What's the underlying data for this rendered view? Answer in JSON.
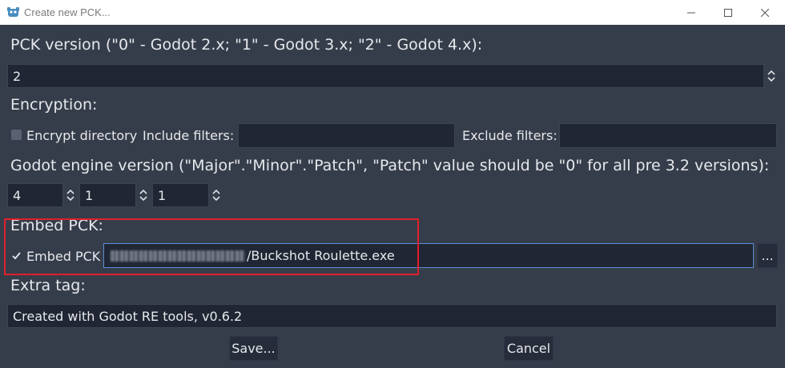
{
  "window": {
    "title": "Create new PCK...",
    "icons": {
      "app": "godot-re-icon",
      "minimize": "minimize-icon",
      "maximize": "maximize-icon",
      "close": "close-icon"
    }
  },
  "pck_version": {
    "label": "PCK version (\"0\" - Godot 2.x; \"1\" - Godot 3.x; \"2\" - Godot 4.x):",
    "value": "2"
  },
  "encryption": {
    "label": "Encryption:",
    "encrypt_directory_label": "Encrypt directory",
    "encrypt_directory_checked": false,
    "include_filters_label": "Include filters:",
    "include_filters_value": "",
    "exclude_filters_label": "Exclude filters:",
    "exclude_filters_value": ""
  },
  "engine_version": {
    "label": "Godot engine version (\"Major\".\"Minor\".\"Patch\", \"Patch\" value should be \"0\" for all pre 3.2 versions):",
    "major": "4",
    "minor": "1",
    "patch": "1"
  },
  "embed": {
    "label": "Embed PCK:",
    "checkbox_label": "Embed PCK",
    "checked": true,
    "path_visible": "/Buckshot Roulette.exe",
    "browse_label": "..."
  },
  "extra_tag": {
    "label": "Extra tag:",
    "value": "Created with Godot RE tools, v0.6.2"
  },
  "buttons": {
    "save": "Save...",
    "cancel": "Cancel"
  },
  "colors": {
    "background": "#363d4a",
    "field": "#202633",
    "highlight": "#e0202a"
  }
}
